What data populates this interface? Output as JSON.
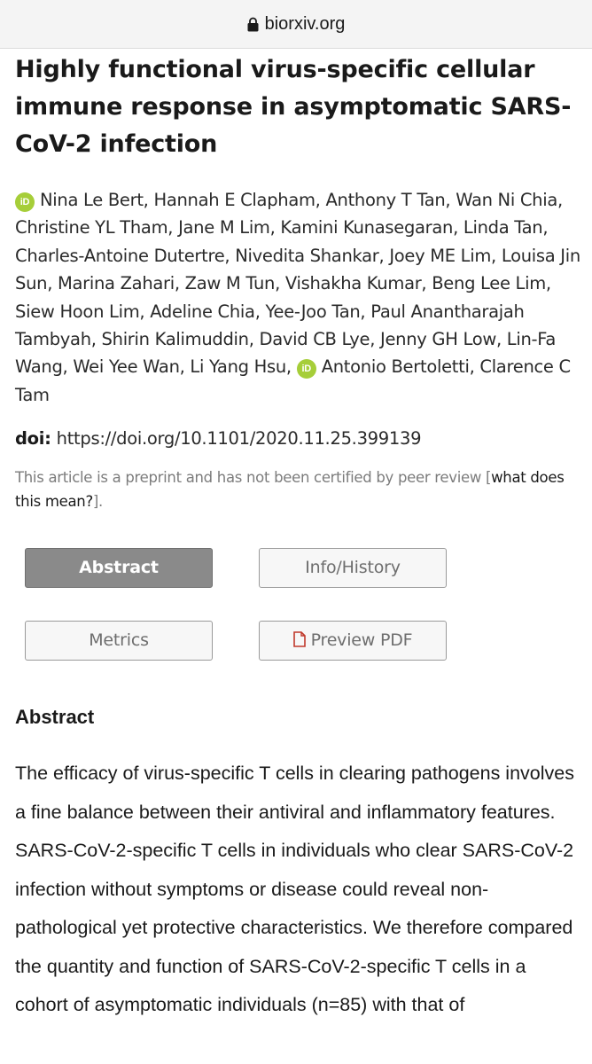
{
  "browser": {
    "url": "biorxiv.org",
    "lock_icon": "lock-icon"
  },
  "article": {
    "title": "Highly functional virus-specific cellular immune response in asymptomatic SARS-CoV-2 infection",
    "authors_part1": "Nina Le Bert, Hannah E Clapham, Anthony T Tan, Wan Ni Chia, Christine YL Tham, Jane M Lim, Kamini Kunasegaran, Linda Tan, Charles-Antoine Dutertre, Nivedita Shankar, Joey ME Lim, Louisa Jin Sun, Marina Zahari, Zaw M Tun, Vishakha Kumar, Beng Lee Lim, Siew Hoon Lim, Adeline Chia, Yee-Joo Tan, Paul Anantharajah Tambyah, Shirin Kalimuddin, David CB Lye, Jenny GH Low, Lin-Fa Wang, Wei Yee Wan, Li Yang Hsu,",
    "authors_part2": "Antonio Bertoletti, Clarence C Tam",
    "orcid_label": "iD",
    "orcid_color": "#a6ce39",
    "doi_label": "doi:",
    "doi_value": "https://doi.org/10.1101/2020.11.25.399139",
    "preprint_note": "This article is a preprint and has not been certified by peer review [",
    "preprint_link": "what does this mean?",
    "preprint_note_end": "]."
  },
  "tabs": {
    "abstract": "Abstract",
    "info_history": "Info/History",
    "metrics": "Metrics",
    "preview_pdf": "Preview PDF",
    "active": "Abstract"
  },
  "abstract": {
    "heading": "Abstract",
    "text": "The efficacy of virus-specific T cells in clearing pathogens involves a fine balance between their antiviral and inflammatory features. SARS-CoV-2-specific T cells in individuals who clear SARS-CoV-2 infection without symptoms or disease could reveal non-pathological yet protective characteristics. We therefore compared the quantity and function of SARS-CoV-2-specific T cells in a cohort of asymptomatic individuals (n=85) with that of"
  },
  "colors": {
    "active_tab": "#8a8a8a",
    "pdf_icon": "#c0392b"
  }
}
